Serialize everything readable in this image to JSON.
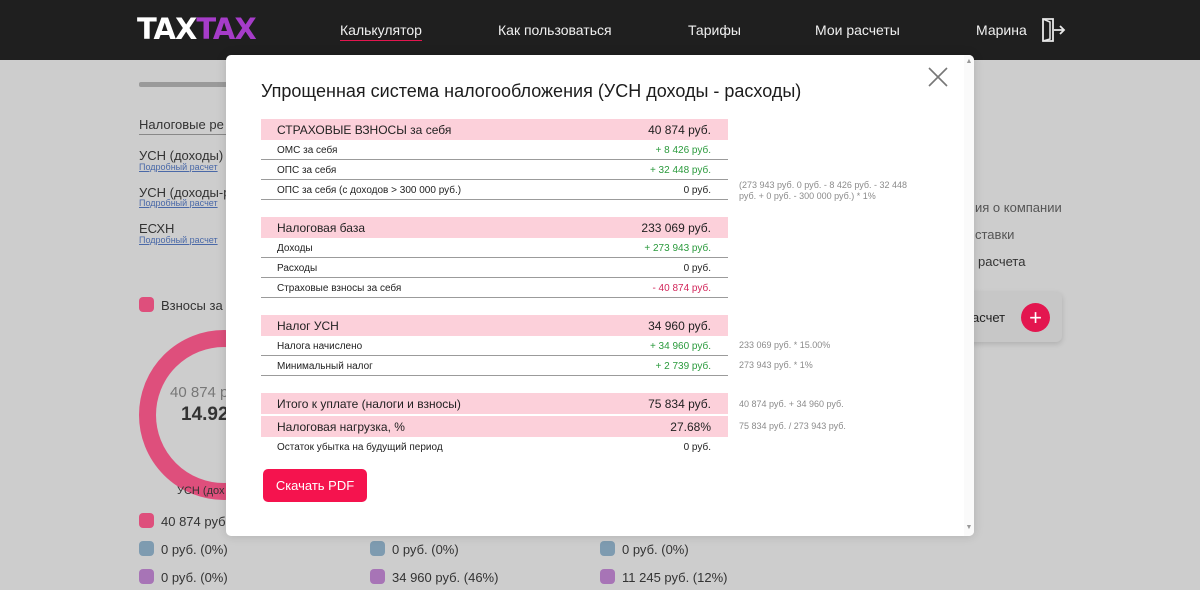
{
  "app": {
    "logo_part1": "TAX",
    "logo_part2": "TAX"
  },
  "nav": {
    "items": [
      "Калькулятор",
      "Как пользоваться",
      "Тарифы",
      "Мои расчеты"
    ],
    "user": "Марина",
    "logout_icon": "logout-icon"
  },
  "background": {
    "section_label": "Налоговые ре",
    "regimes": [
      {
        "name": "УСН (доходы)",
        "link": "Подробный расчет"
      },
      {
        "name": "УСН (доходы-ра",
        "link": "Подробный расчет"
      },
      {
        "name": "ЕСХН",
        "link": "Подробный расчет"
      }
    ],
    "legend_label": "Взносы за с",
    "donut_value": "40 874 р",
    "donut_percent": "14.92",
    "donut_caption": "УСН (дох",
    "side_items": [
      "ия о компании",
      "ставки",
      "расчета"
    ],
    "side_card_label": "асчет",
    "bottom_values": [
      [
        "40 874 руб.",
        "",
        ""
      ],
      [
        "0 руб. (0%)",
        "0 руб. (0%)",
        "0 руб. (0%)"
      ],
      [
        "0 руб. (0%)",
        "34 960 руб. (46%)",
        "11 245 руб. (12%)"
      ]
    ],
    "colors": {
      "pink": "#de4f7c",
      "blue": "#7e9bb0",
      "purple": "#a774b6"
    }
  },
  "modal": {
    "title": "Упрощенная система налогообложения (УСН доходы - расходы)",
    "close_icon": "close-icon",
    "sections": [
      {
        "header": {
          "label": "СТРАХОВЫЕ ВЗНОСЫ за себя",
          "value": "40 874 руб."
        },
        "rows": [
          {
            "label": "ОМС за себя",
            "value": "+ 8 426 руб.",
            "tone": "green",
            "note": ""
          },
          {
            "label": "ОПС за себя",
            "value": "+ 32 448 руб.",
            "tone": "green",
            "note": ""
          },
          {
            "label": "ОПС за себя (с доходов > 300 000 руб.)",
            "value": "0 руб.",
            "tone": "",
            "note": "(273 943 руб. 0 руб. - 8 426 руб. - 32 448 руб. + 0 руб. - 300 000 руб.) * 1%"
          }
        ]
      },
      {
        "header": {
          "label": "Налоговая база",
          "value": "233 069 руб."
        },
        "rows": [
          {
            "label": "Доходы",
            "value": "+ 273 943 руб.",
            "tone": "green",
            "note": ""
          },
          {
            "label": "Расходы",
            "value": "0 руб.",
            "tone": "",
            "note": ""
          },
          {
            "label": "Страховые взносы за себя",
            "value": "- 40 874 руб.",
            "tone": "red",
            "note": ""
          }
        ]
      },
      {
        "header": {
          "label": "Налог УСН",
          "value": "34 960 руб."
        },
        "rows": [
          {
            "label": "Налога начислено",
            "value": "+ 34 960 руб.",
            "tone": "green",
            "note": "233 069 руб. * 15.00%"
          },
          {
            "label": "Минимальный налог",
            "value": "+ 2 739 руб.",
            "tone": "green",
            "note": "273 943 руб. * 1%"
          }
        ]
      }
    ],
    "totals": [
      {
        "label": "Итого к уплате (налоги и взносы)",
        "value": "75 834 руб.",
        "note": "40 874 руб. + 34 960 руб."
      },
      {
        "label": "Налоговая нагрузка, %",
        "value": "27.68%",
        "note": "75 834 руб. / 273 943 руб."
      }
    ],
    "remainder": {
      "label": "Остаток убытка на будущий период",
      "value": "0 руб."
    },
    "pdf_button": "Скачать PDF",
    "colors": {
      "header_bg": "#fcd0da",
      "green": "#2a9a3c",
      "red": "#d2265a",
      "button": "#f5134e"
    }
  }
}
